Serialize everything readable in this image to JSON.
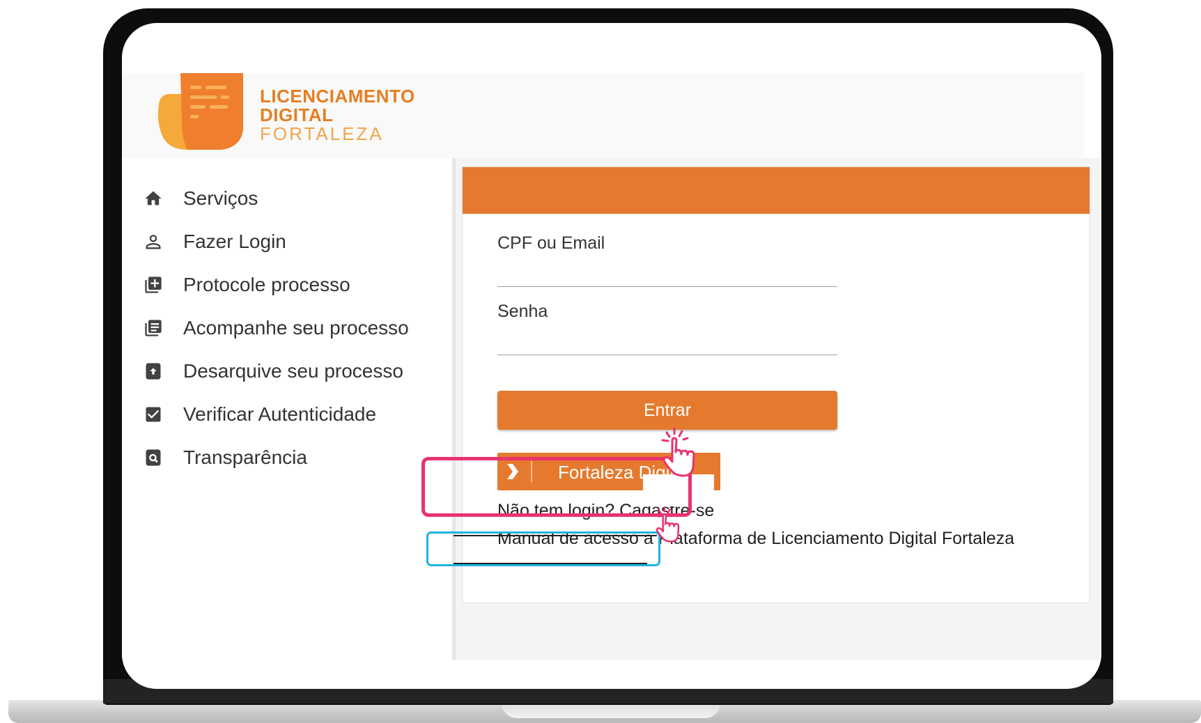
{
  "brand": {
    "line1": "LICENCIAMENTO",
    "line2": "DIGITAL",
    "line3": "FORTALEZA",
    "logo_icon": "document-logo-icon",
    "primary_color": "#e57a2e",
    "secondary_color": "#f5a93b"
  },
  "sidebar": {
    "items": [
      {
        "label": "Serviços",
        "icon": "home-icon"
      },
      {
        "label": "Fazer Login",
        "icon": "user-icon"
      },
      {
        "label": "Protocole processo",
        "icon": "add-box-icon"
      },
      {
        "label": "Acompanhe seu processo",
        "icon": "list-icon"
      },
      {
        "label": "Desarquive seu processo",
        "icon": "unarchive-icon"
      },
      {
        "label": "Verificar Autenticidade",
        "icon": "check-box-icon"
      },
      {
        "label": "Transparência",
        "icon": "search-document-icon"
      }
    ]
  },
  "login": {
    "cpf_label": "CPF ou Email",
    "cpf_value": "",
    "senha_label": "Senha",
    "senha_value": "",
    "entrar_label": "Entrar",
    "fortaleza_digital_label": "Fortaleza Digital",
    "fortaleza_digital_icon": "chevron-right-icon",
    "signup_link": "Não tem login? Cadastre-se",
    "manual_link": "Manual de acesso a Plataforma de Licenciamento Digital Fortaleza"
  },
  "annotations": {
    "highlight_primary_color": "#e8336d",
    "highlight_secondary_color": "#1fb3e0",
    "cursor_icon": "hand-pointer-icon"
  }
}
